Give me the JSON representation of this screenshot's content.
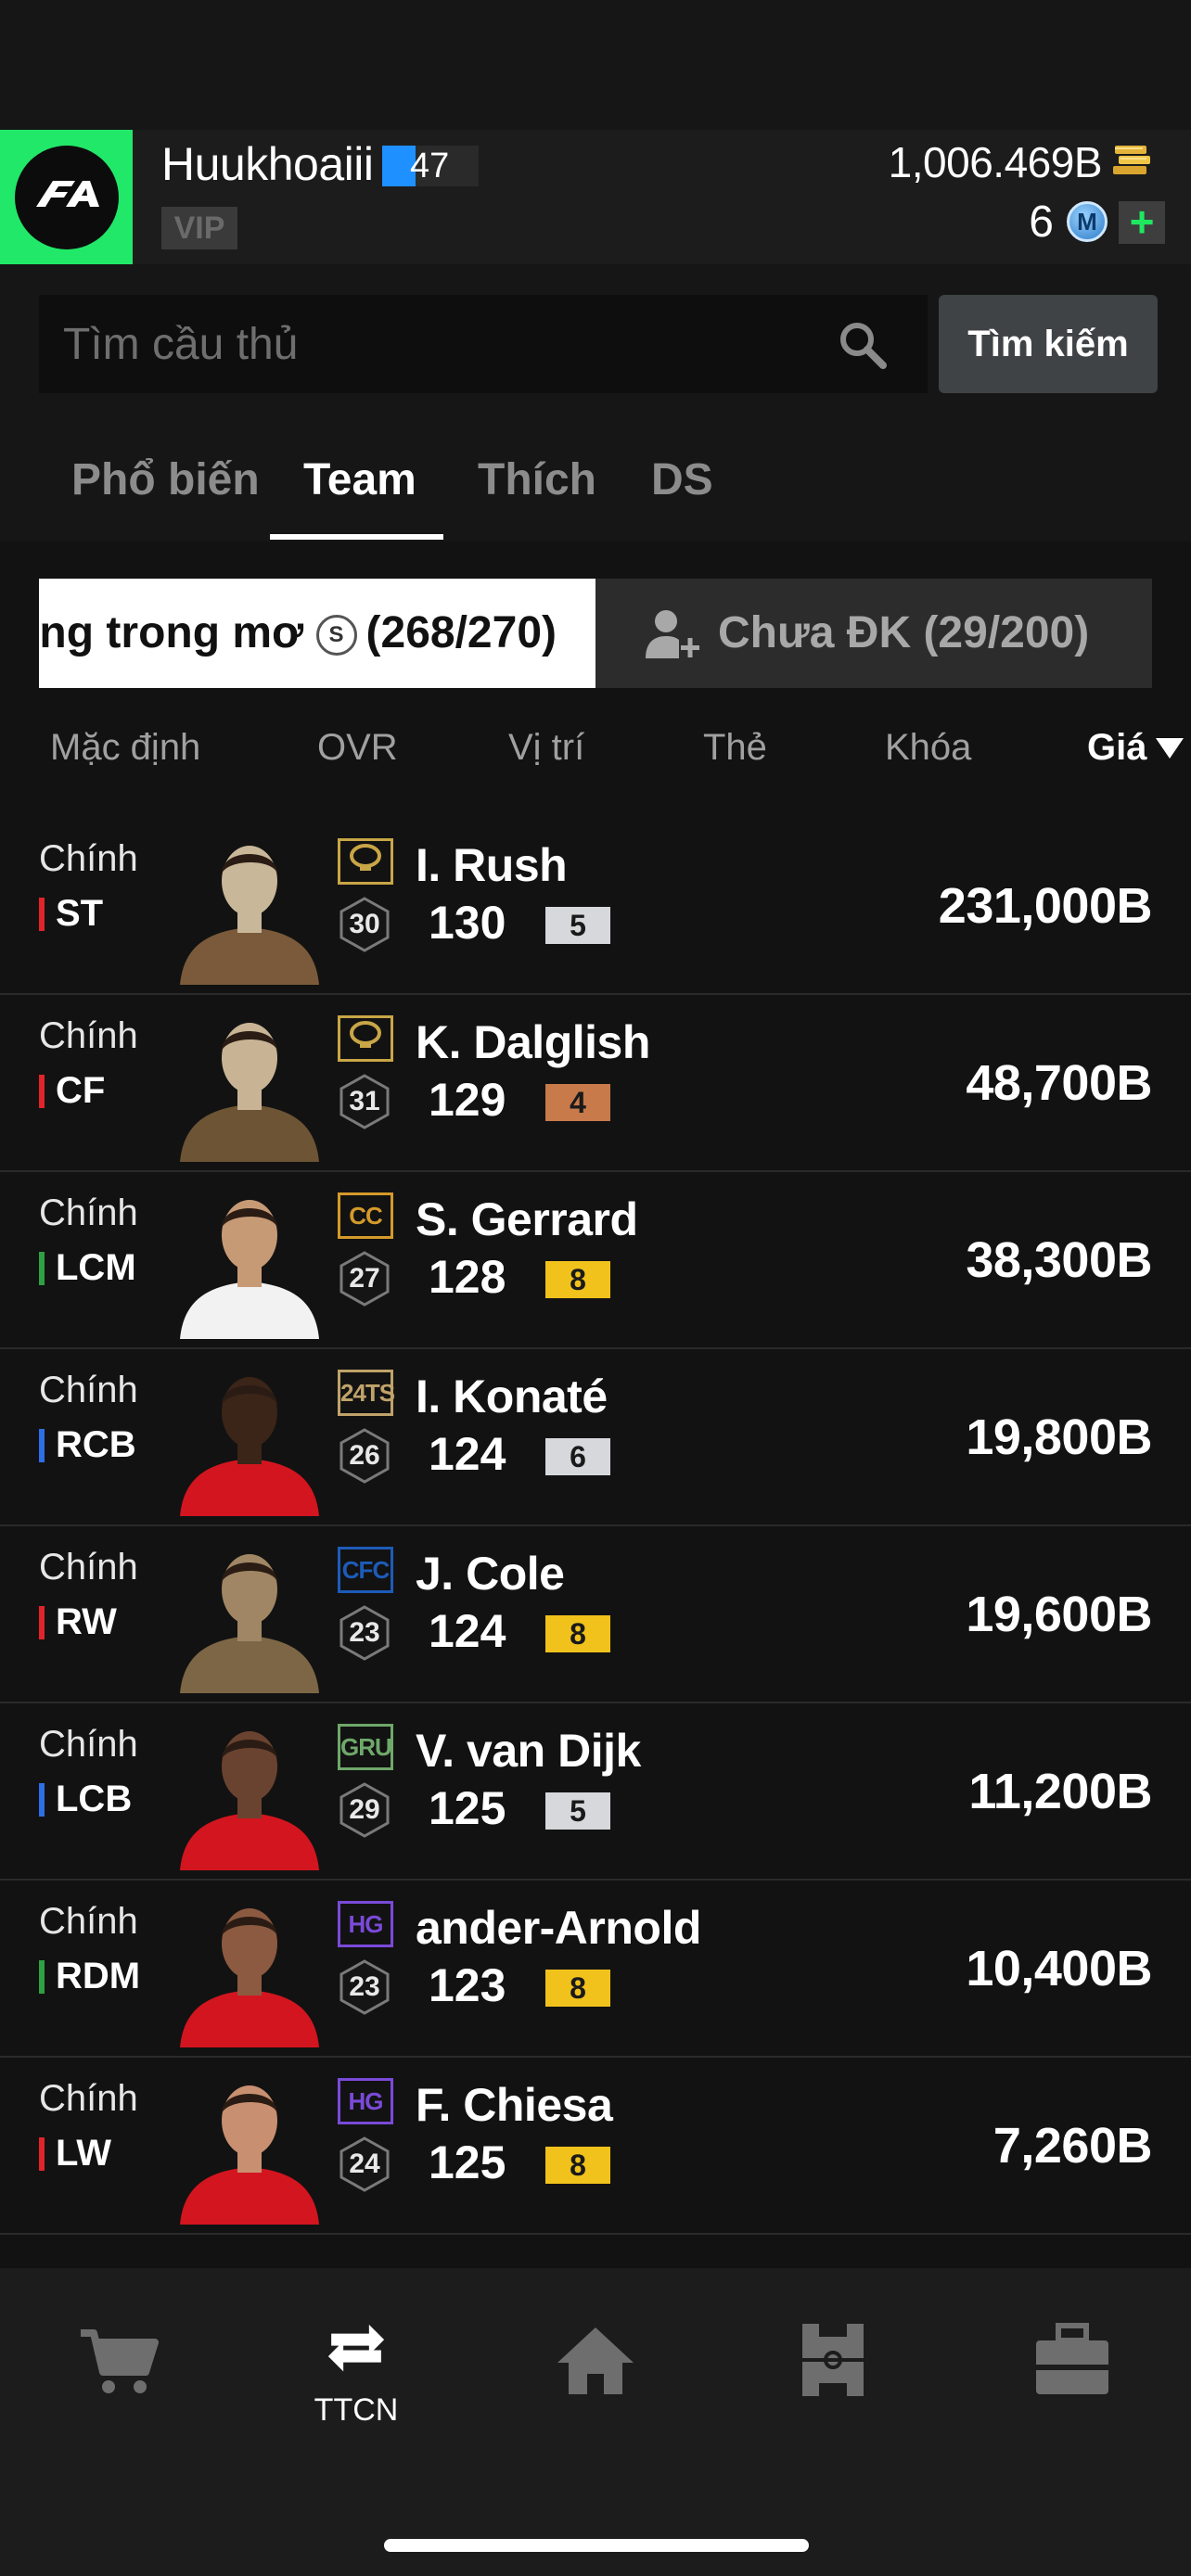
{
  "user": {
    "name": "Huukhoaiii",
    "level": "47",
    "vip_label": "VIP",
    "coins": "1,006.469B",
    "m_points": "6",
    "m_badge": "M",
    "add_label": "+"
  },
  "search": {
    "placeholder": "Tìm cầu thủ",
    "button_label": "Tìm kiếm"
  },
  "tabs": [
    {
      "label": "Phổ biến",
      "active": false
    },
    {
      "label": "Team",
      "active": true
    },
    {
      "label": "Thích",
      "active": false
    },
    {
      "label": "DS",
      "active": false
    }
  ],
  "segments": {
    "left_label": "ng trong mơ",
    "left_badge": "S",
    "left_count": "(268/270)",
    "right_label": "Chưa ĐK (29/200)"
  },
  "sort": {
    "default": "Mặc định",
    "ovr": "OVR",
    "position": "Vị trí",
    "card": "Thẻ",
    "lock": "Khóa",
    "price": "Giá"
  },
  "players": [
    {
      "status": "Chính",
      "position": "ST",
      "pos_color": "#e0242a",
      "season": "🏆",
      "season_color": "#c9a646",
      "rank": "30",
      "name": "I. Rush",
      "ovr": "130",
      "upgrade": "5",
      "upgrade_color": "#d6d8dc",
      "price": "231,000B",
      "kit": "#7a5a3a",
      "skin": "#c9b79a"
    },
    {
      "status": "Chính",
      "position": "CF",
      "pos_color": "#e0242a",
      "season": "🏆",
      "season_color": "#c9a646",
      "rank": "31",
      "name": "K. Dalglish",
      "ovr": "129",
      "upgrade": "4",
      "upgrade_color": "#c87a4a",
      "price": "48,700B",
      "kit": "#6c5434",
      "skin": "#c8b494"
    },
    {
      "status": "Chính",
      "position": "LCM",
      "pos_color": "#2ea043",
      "season": "CC",
      "season_color": "#d49a2a",
      "rank": "27",
      "name": "S. Gerrard",
      "ovr": "128",
      "upgrade": "8",
      "upgrade_color": "#f1c21b",
      "price": "38,300B",
      "kit": "#f2f2f2",
      "skin": "#c79a76"
    },
    {
      "status": "Chính",
      "position": "RCB",
      "pos_color": "#2f6fe6",
      "season": "24TS",
      "season_color": "#c0a36a",
      "rank": "26",
      "name": "I. Konaté",
      "ovr": "124",
      "upgrade": "6",
      "upgrade_color": "#d6d8dc",
      "price": "19,800B",
      "kit": "#d3151f",
      "skin": "#3b2418"
    },
    {
      "status": "Chính",
      "position": "RW",
      "pos_color": "#e0242a",
      "season": "CFC",
      "season_color": "#1d5bb8",
      "rank": "23",
      "name": "J. Cole",
      "ovr": "124",
      "upgrade": "8",
      "upgrade_color": "#f1c21b",
      "price": "19,600B",
      "kit": "#7d6646",
      "skin": "#a08664"
    },
    {
      "status": "Chính",
      "position": "LCB",
      "pos_color": "#2f6fe6",
      "season": "GRU",
      "season_color": "#6fa86a",
      "rank": "29",
      "name": "V. van Dijk",
      "ovr": "125",
      "upgrade": "5",
      "upgrade_color": "#d6d8dc",
      "price": "11,200B",
      "kit": "#d3151f",
      "skin": "#6a4330"
    },
    {
      "status": "Chính",
      "position": "RDM",
      "pos_color": "#2ea043",
      "season": "HG",
      "season_color": "#7a4ad8",
      "rank": "23",
      "name": "ander-Arnold",
      "ovr": "123",
      "upgrade": "8",
      "upgrade_color": "#f1c21b",
      "price": "10,400B",
      "kit": "#d3151f",
      "skin": "#8c5a40"
    },
    {
      "status": "Chính",
      "position": "LW",
      "pos_color": "#e0242a",
      "season": "HG",
      "season_color": "#7a4ad8",
      "rank": "24",
      "name": "F. Chiesa",
      "ovr": "125",
      "upgrade": "8",
      "upgrade_color": "#f1c21b",
      "price": "7,260B",
      "kit": "#d3151f",
      "skin": "#c89070"
    }
  ],
  "nav": {
    "shop": "",
    "transfer": "TTCN",
    "home": "",
    "squad": "",
    "bag": ""
  },
  "colors": {
    "accent_green": "#21e868",
    "level_blue": "#1e90ff",
    "background": "#161616"
  }
}
